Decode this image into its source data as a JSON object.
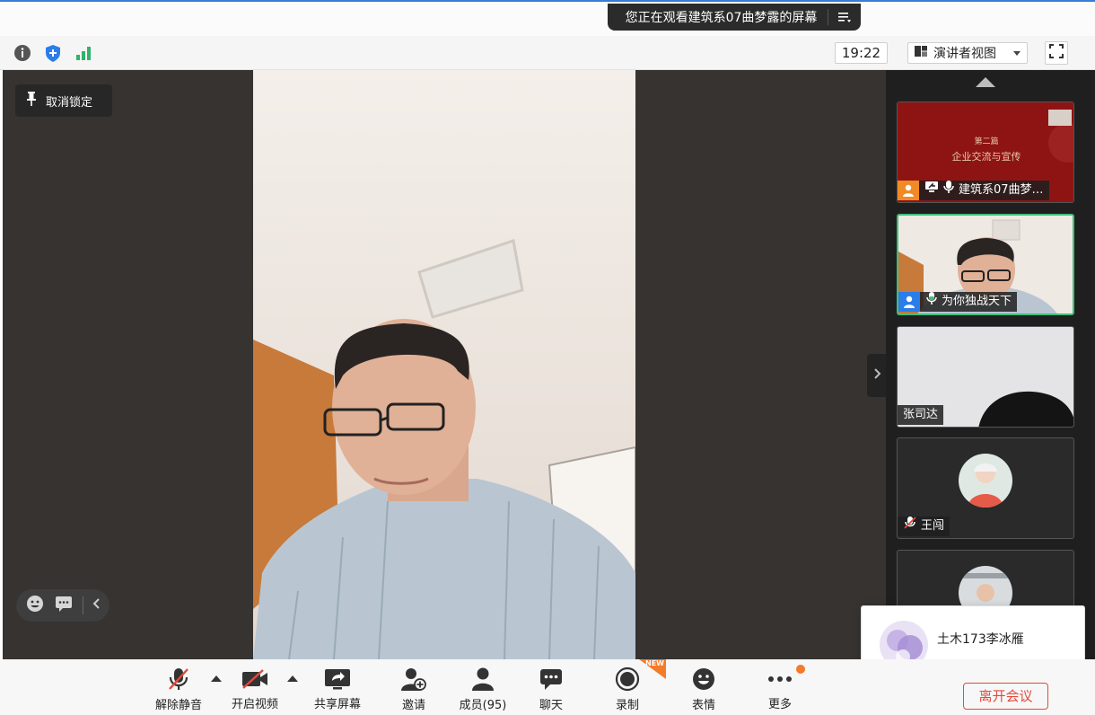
{
  "share_banner": {
    "text": "您正在观看建筑系07曲梦露的屏幕",
    "menu_icon": "list-menu-icon"
  },
  "info_bar": {
    "icons": [
      "info-icon",
      "shield-icon",
      "signal-icon"
    ],
    "clock": "19:22",
    "view_mode": "演讲者视图",
    "fullscreen_icon": "fullscreen-icon"
  },
  "stage": {
    "unlock_label": "取消锁定"
  },
  "sidebar": {
    "tiles": [
      {
        "name": "建筑系07曲梦…",
        "slide_title": "第二篇",
        "slide_subtitle": "企业交流与宣传"
      },
      {
        "name": "为你独战天下"
      },
      {
        "name": "张司达"
      },
      {
        "name": "王闯"
      },
      {
        "name": ""
      }
    ]
  },
  "toast": {
    "name": "土木173李冰雁"
  },
  "toolbar": {
    "buttons": [
      {
        "label": "解除静音"
      },
      {
        "label": "开启视频"
      },
      {
        "label": "共享屏幕"
      },
      {
        "label": "邀请"
      },
      {
        "label": "成员(95)"
      },
      {
        "label": "聊天"
      },
      {
        "label": "录制"
      },
      {
        "label": "表情"
      },
      {
        "label": "更多"
      }
    ],
    "new_badge": "NEW",
    "leave_label": "离开会议"
  },
  "colors": {
    "accent_green": "#3fbf79",
    "leave_red": "#e04b3b",
    "badge_orange": "#f37b2a",
    "stage_bg": "#363331"
  }
}
